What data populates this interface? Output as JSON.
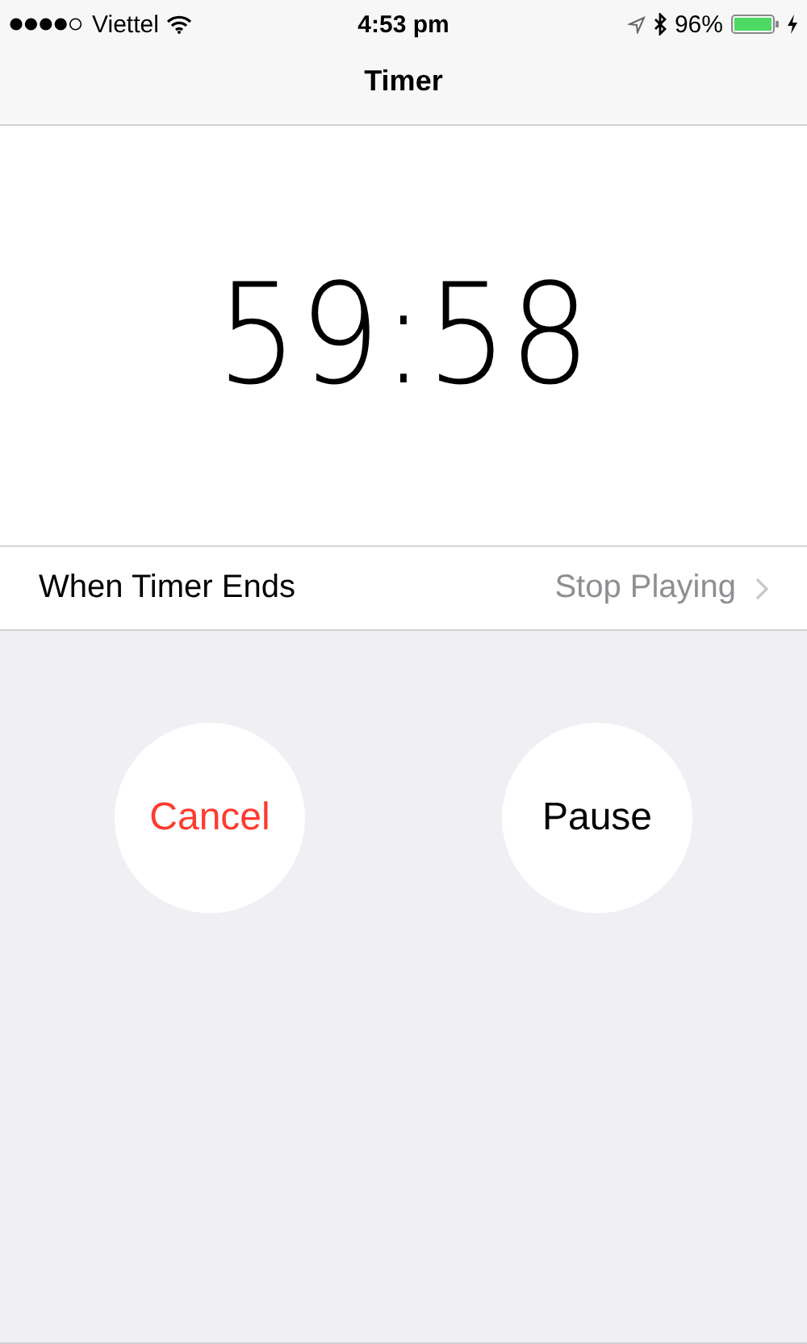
{
  "status_bar": {
    "carrier": "Viettel",
    "time": "4:53 pm",
    "battery": "96%"
  },
  "nav": {
    "title": "Timer"
  },
  "timer": {
    "remaining": "59:58"
  },
  "setting": {
    "label": "When Timer Ends",
    "value": "Stop Playing"
  },
  "buttons": [
    {
      "label": "Cancel",
      "kind": "destructive"
    },
    {
      "label": "Pause",
      "kind": "default"
    }
  ]
}
